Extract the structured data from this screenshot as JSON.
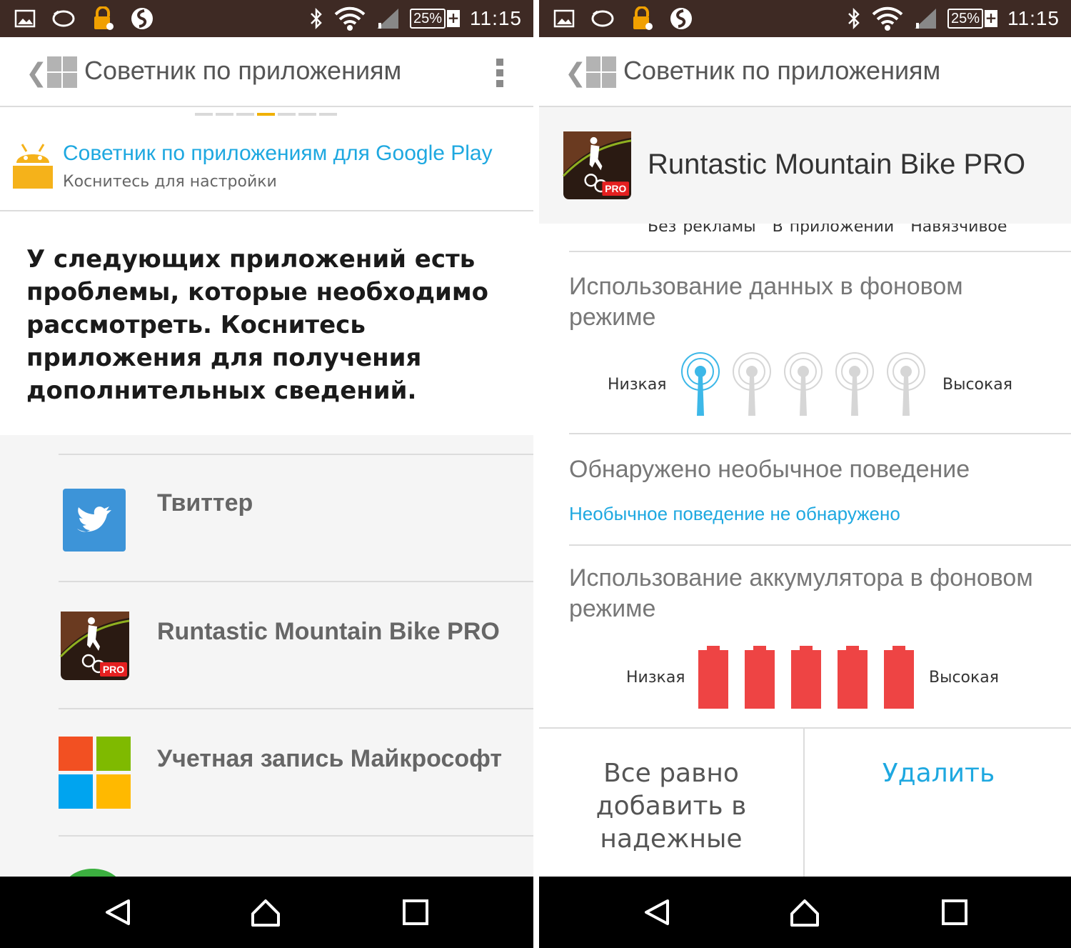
{
  "status": {
    "battery": "25%",
    "battery_plus": "+",
    "time": "11:15",
    "bg_color": "#3e2a24"
  },
  "actionbar": {
    "back_glyph": "❮",
    "title": "Советник по приложениям"
  },
  "left": {
    "pager": {
      "count": 7,
      "active_index": 3,
      "active_color": "#f0b000"
    },
    "google_play": {
      "title": "Советник по приложениям для Google Play",
      "subtitle": "Коснитесь для настройки"
    },
    "intro": "У следующих приложений есть проблемы, которые необходимо рассмотреть. Коснитесь приложения для получения дополнительных сведений.",
    "apps": [
      {
        "name": "Твиттер",
        "icon": "twitter-icon"
      },
      {
        "name": "Runtastic Mountain Bike PRO",
        "icon": "runtastic-icon"
      },
      {
        "name": "Учетная запись Майкрософт",
        "icon": "microsoft-icon"
      }
    ]
  },
  "right": {
    "app_title": "Runtastic Mountain Bike PRO",
    "pro_badge": "PRO",
    "cut_labels": [
      "Без рекламы",
      "В приложении",
      "Навязчивое"
    ],
    "background_data": {
      "title": "Использование данных в фоновом режиме",
      "low": "Низкая",
      "high": "Высокая",
      "level": 1,
      "max": 5,
      "active_color": "#3db8e8",
      "inactive_color": "#d6d6d6"
    },
    "unusual": {
      "title": "Обнаружено необычное поведение",
      "status": "Необычное поведение не обнаружено"
    },
    "battery": {
      "title": "Использование аккумулятора в фоновом режиме",
      "low": "Низкая",
      "high": "Высокая",
      "level": 5,
      "max": 5,
      "color": "#ee4444"
    },
    "buttons": {
      "add_trusted": "Все равно добавить в надежные",
      "remove": "Удалить"
    }
  },
  "accent_blue": "#1ea8e0"
}
